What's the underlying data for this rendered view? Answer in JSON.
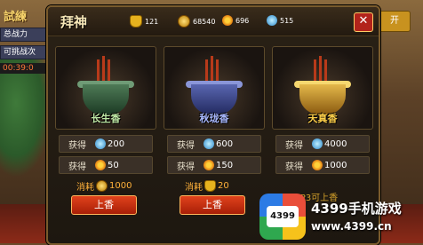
{
  "background": {
    "top_left_title": "試練",
    "tags": [
      "总战力",
      "可挑战次",
      "00:39:0"
    ],
    "corner_button": "开"
  },
  "dialog": {
    "title": "拜神",
    "resources": [
      {
        "icon": "gold-ingot-icon",
        "value": "121"
      },
      {
        "icon": "coin-icon",
        "value": "68540"
      },
      {
        "icon": "flower-icon",
        "value": "696"
      },
      {
        "icon": "gem-icon",
        "value": "515"
      }
    ],
    "close_label": "✕"
  },
  "cards": [
    {
      "name": "长生香",
      "color": "green",
      "reward1_label": "获得",
      "reward1_value": "200",
      "reward1_icon": "gem-icon",
      "reward2_label": "获得",
      "reward2_value": "50",
      "reward2_icon": "flower-icon",
      "cost_label": "消耗",
      "cost_value": "1000",
      "cost_icon": "coin-icon",
      "button": "上香"
    },
    {
      "name": "秋珑香",
      "color": "blue",
      "reward1_label": "获得",
      "reward1_value": "600",
      "reward1_icon": "gem-icon",
      "reward2_label": "获得",
      "reward2_value": "150",
      "reward2_icon": "flower-icon",
      "cost_label": "消耗",
      "cost_value": "20",
      "cost_icon": "gold-ingot-icon",
      "button": "上香"
    },
    {
      "name": "天真香",
      "color": "gold",
      "reward1_label": "获得",
      "reward1_value": "4000",
      "reward1_icon": "gem-icon",
      "reward2_label": "获得",
      "reward2_value": "1000",
      "reward2_icon": "flower-icon",
      "cost_label": "",
      "cost_value": "VIP3可上香",
      "button": ""
    }
  ],
  "watermark": {
    "badge": "4399",
    "name": "4399手机游戏",
    "url": "www.4399.cn"
  }
}
